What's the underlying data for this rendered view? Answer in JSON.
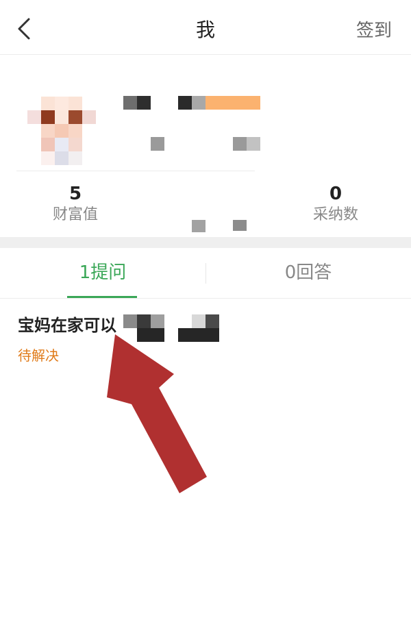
{
  "header": {
    "title": "我",
    "checkin_label": "签到"
  },
  "profile": {
    "stats": {
      "wealth_value": "5",
      "wealth_label": "财富值",
      "adopted_value": "0",
      "adopted_label": "采纳数"
    }
  },
  "tabs": [
    {
      "label": "1提问",
      "active": true
    },
    {
      "label": "0回答",
      "active": false
    }
  ],
  "questions": [
    {
      "title": "宝妈在家可以",
      "status": "待解决"
    }
  ],
  "colors": {
    "accent_green": "#3aa757",
    "status_orange": "#e07b1a",
    "annotation_arrow": "#b03030"
  }
}
